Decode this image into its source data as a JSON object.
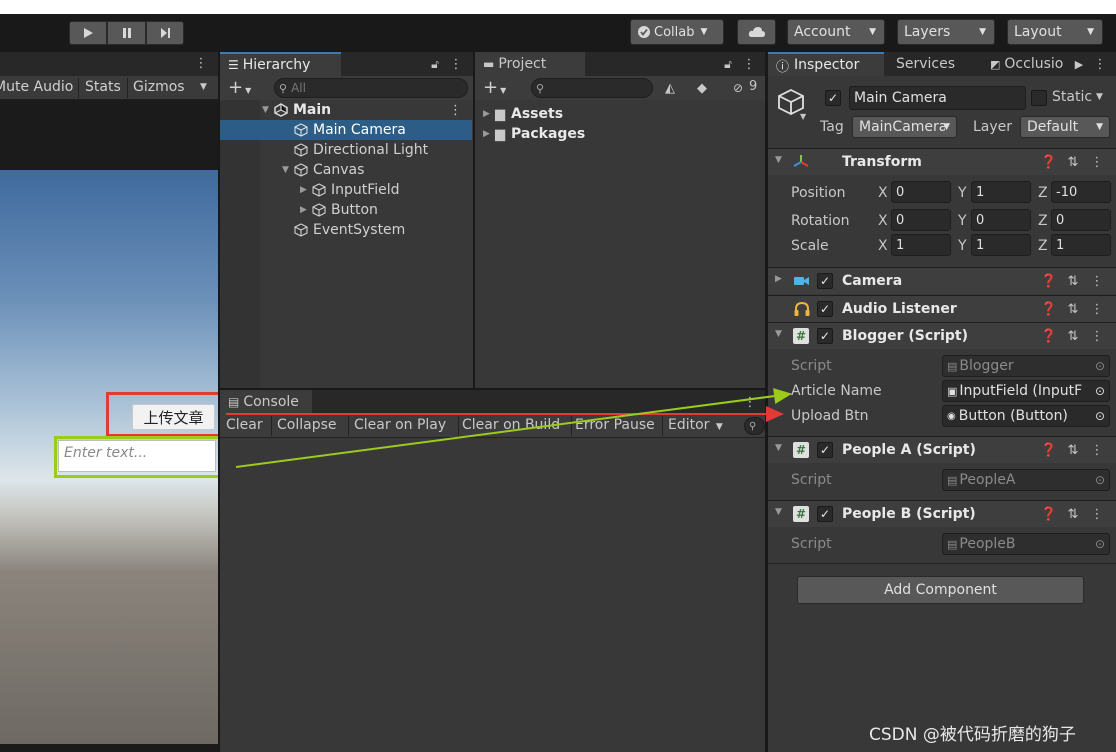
{
  "toolbar": {
    "collab": "Collab",
    "account": "Account",
    "layers": "Layers",
    "layout": "Layout"
  },
  "game_view": {
    "mute_audio": "Mute Audio",
    "stats": "Stats",
    "gizmos": "Gizmos",
    "upload_button": "上传文章",
    "input_placeholder": "Enter text..."
  },
  "hierarchy": {
    "tab": "Hierarchy",
    "search_placeholder": "All",
    "scene": "Main",
    "items": [
      {
        "label": "Main Camera"
      },
      {
        "label": "Directional Light"
      },
      {
        "label": "Canvas"
      },
      {
        "label": "InputField"
      },
      {
        "label": "Button"
      },
      {
        "label": "EventSystem"
      }
    ]
  },
  "project": {
    "tab": "Project",
    "hidden_count": "9",
    "folders": [
      "Assets",
      "Packages"
    ]
  },
  "console": {
    "tab": "Console",
    "buttons": [
      "Clear",
      "Collapse",
      "Clear on Play",
      "Clear on Build",
      "Error Pause",
      "Editor"
    ]
  },
  "inspector": {
    "tabs": [
      "Inspector",
      "Services",
      "Occlusio"
    ],
    "object_name": "Main Camera",
    "static_label": "Static",
    "tag_label": "Tag",
    "tag_value": "MainCamera",
    "layer_label": "Layer",
    "layer_value": "Default",
    "transform": {
      "title": "Transform",
      "position_label": "Position",
      "rotation_label": "Rotation",
      "scale_label": "Scale",
      "axis_x": "X",
      "axis_y": "Y",
      "axis_z": "Z",
      "position": [
        "0",
        "1",
        "-10"
      ],
      "rotation": [
        "0",
        "0",
        "0"
      ],
      "scale": [
        "1",
        "1",
        "1"
      ]
    },
    "camera": {
      "title": "Camera"
    },
    "audio_listener": {
      "title": "Audio Listener"
    },
    "blogger": {
      "title": "Blogger (Script)",
      "script_label": "Script",
      "script_value": "Blogger",
      "article_name_label": "Article Name",
      "article_name_value": "InputField (InputF",
      "upload_btn_label": "Upload Btn",
      "upload_btn_value": "Button (Button)"
    },
    "people_a": {
      "title": "People A (Script)",
      "script_label": "Script",
      "script_value": "PeopleA"
    },
    "people_b": {
      "title": "People B (Script)",
      "script_label": "Script",
      "script_value": "PeopleB"
    },
    "add_component": "Add Component"
  },
  "watermark": "CSDN @被代码折磨的狗子",
  "colors": {
    "annotation_red": "#e53935",
    "annotation_green": "#9ccc1a",
    "selection": "#2c5d87",
    "tab_accent": "#3a79bb"
  }
}
